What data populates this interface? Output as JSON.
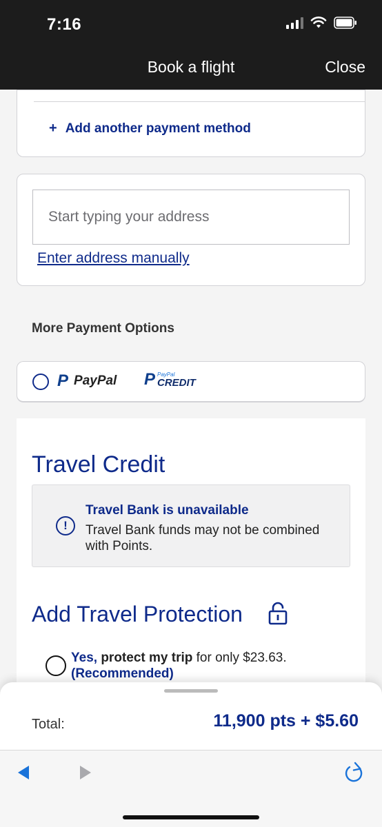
{
  "status_bar": {
    "time": "7:16"
  },
  "header": {
    "title": "Book a flight",
    "close_label": "Close"
  },
  "payment": {
    "add_another_label": "Add another payment method",
    "add_icon": "plus-icon"
  },
  "address": {
    "placeholder": "Start typing your address",
    "manual_link": "Enter address manually"
  },
  "more_payment": {
    "heading": "More Payment Options",
    "paypal_label": "PayPal",
    "paypal_credit_small": "PayPal",
    "paypal_credit_big": "CREDIT"
  },
  "travel_credit": {
    "title": "Travel Credit",
    "notice_title": "Travel Bank is unavailable",
    "notice_body": "Travel Bank funds may not be combined with Points.",
    "notice_icon": "info-icon"
  },
  "travel_protection": {
    "title": "Add Travel Protection",
    "lock_icon": "lock-icon",
    "option_yes": "Yes,",
    "option_strong": "protect my trip",
    "option_rest": "for only $23.63.",
    "option_recommended": "(Recommended)"
  },
  "summary": {
    "total_label": "Total:",
    "total_value": "11,900 pts + $5.60"
  },
  "toolbar": {
    "back_icon": "back-arrow-icon",
    "forward_icon": "forward-arrow-icon",
    "reload_icon": "reload-icon"
  },
  "colors": {
    "brand_navy": "#0e2a8a",
    "bar_bg": "#1c1c1c",
    "accent_blue": "#1a73d9"
  }
}
